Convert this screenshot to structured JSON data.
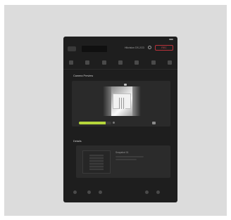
{
  "app": {
    "model_label": "Hikvision DS-2CD",
    "record_label": "REC"
  },
  "sections": {
    "preview_label": "Camera Preview",
    "details_label": "Details"
  },
  "playback": {
    "progress_fraction": 0.82
  },
  "details": {
    "doc_text": "Snapshot 01"
  },
  "colors": {
    "accent": "#b5d63b",
    "record": "#b8323a",
    "background": "#1e1e1e"
  },
  "icons": {
    "back": "back-arrow-icon",
    "settings": "gear-icon",
    "camera": "camera-icon"
  }
}
